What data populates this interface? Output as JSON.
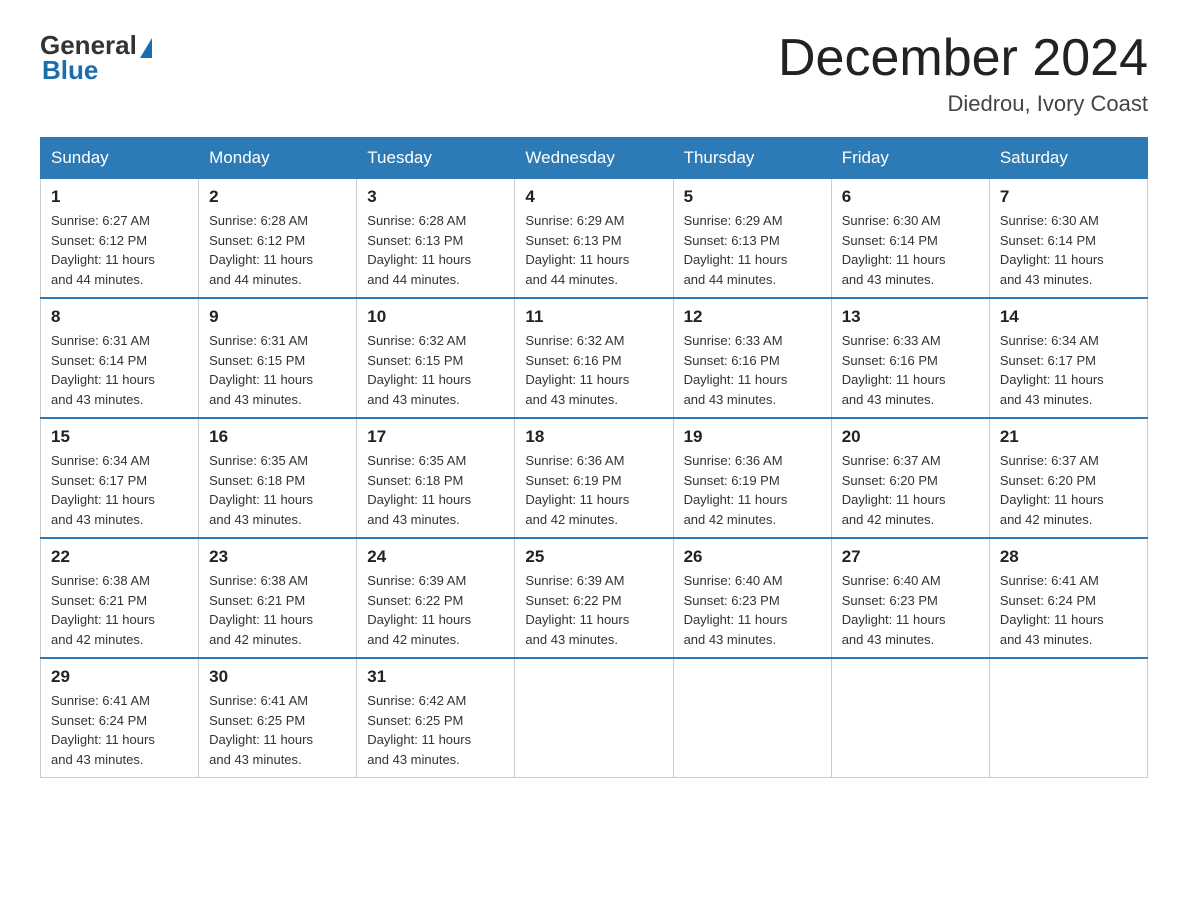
{
  "logo": {
    "general": "General",
    "blue": "Blue"
  },
  "title": "December 2024",
  "location": "Diedrou, Ivory Coast",
  "days_of_week": [
    "Sunday",
    "Monday",
    "Tuesday",
    "Wednesday",
    "Thursday",
    "Friday",
    "Saturday"
  ],
  "weeks": [
    [
      {
        "day": "1",
        "info": "Sunrise: 6:27 AM\nSunset: 6:12 PM\nDaylight: 11 hours\nand 44 minutes."
      },
      {
        "day": "2",
        "info": "Sunrise: 6:28 AM\nSunset: 6:12 PM\nDaylight: 11 hours\nand 44 minutes."
      },
      {
        "day": "3",
        "info": "Sunrise: 6:28 AM\nSunset: 6:13 PM\nDaylight: 11 hours\nand 44 minutes."
      },
      {
        "day": "4",
        "info": "Sunrise: 6:29 AM\nSunset: 6:13 PM\nDaylight: 11 hours\nand 44 minutes."
      },
      {
        "day": "5",
        "info": "Sunrise: 6:29 AM\nSunset: 6:13 PM\nDaylight: 11 hours\nand 44 minutes."
      },
      {
        "day": "6",
        "info": "Sunrise: 6:30 AM\nSunset: 6:14 PM\nDaylight: 11 hours\nand 43 minutes."
      },
      {
        "day": "7",
        "info": "Sunrise: 6:30 AM\nSunset: 6:14 PM\nDaylight: 11 hours\nand 43 minutes."
      }
    ],
    [
      {
        "day": "8",
        "info": "Sunrise: 6:31 AM\nSunset: 6:14 PM\nDaylight: 11 hours\nand 43 minutes."
      },
      {
        "day": "9",
        "info": "Sunrise: 6:31 AM\nSunset: 6:15 PM\nDaylight: 11 hours\nand 43 minutes."
      },
      {
        "day": "10",
        "info": "Sunrise: 6:32 AM\nSunset: 6:15 PM\nDaylight: 11 hours\nand 43 minutes."
      },
      {
        "day": "11",
        "info": "Sunrise: 6:32 AM\nSunset: 6:16 PM\nDaylight: 11 hours\nand 43 minutes."
      },
      {
        "day": "12",
        "info": "Sunrise: 6:33 AM\nSunset: 6:16 PM\nDaylight: 11 hours\nand 43 minutes."
      },
      {
        "day": "13",
        "info": "Sunrise: 6:33 AM\nSunset: 6:16 PM\nDaylight: 11 hours\nand 43 minutes."
      },
      {
        "day": "14",
        "info": "Sunrise: 6:34 AM\nSunset: 6:17 PM\nDaylight: 11 hours\nand 43 minutes."
      }
    ],
    [
      {
        "day": "15",
        "info": "Sunrise: 6:34 AM\nSunset: 6:17 PM\nDaylight: 11 hours\nand 43 minutes."
      },
      {
        "day": "16",
        "info": "Sunrise: 6:35 AM\nSunset: 6:18 PM\nDaylight: 11 hours\nand 43 minutes."
      },
      {
        "day": "17",
        "info": "Sunrise: 6:35 AM\nSunset: 6:18 PM\nDaylight: 11 hours\nand 43 minutes."
      },
      {
        "day": "18",
        "info": "Sunrise: 6:36 AM\nSunset: 6:19 PM\nDaylight: 11 hours\nand 42 minutes."
      },
      {
        "day": "19",
        "info": "Sunrise: 6:36 AM\nSunset: 6:19 PM\nDaylight: 11 hours\nand 42 minutes."
      },
      {
        "day": "20",
        "info": "Sunrise: 6:37 AM\nSunset: 6:20 PM\nDaylight: 11 hours\nand 42 minutes."
      },
      {
        "day": "21",
        "info": "Sunrise: 6:37 AM\nSunset: 6:20 PM\nDaylight: 11 hours\nand 42 minutes."
      }
    ],
    [
      {
        "day": "22",
        "info": "Sunrise: 6:38 AM\nSunset: 6:21 PM\nDaylight: 11 hours\nand 42 minutes."
      },
      {
        "day": "23",
        "info": "Sunrise: 6:38 AM\nSunset: 6:21 PM\nDaylight: 11 hours\nand 42 minutes."
      },
      {
        "day": "24",
        "info": "Sunrise: 6:39 AM\nSunset: 6:22 PM\nDaylight: 11 hours\nand 42 minutes."
      },
      {
        "day": "25",
        "info": "Sunrise: 6:39 AM\nSunset: 6:22 PM\nDaylight: 11 hours\nand 43 minutes."
      },
      {
        "day": "26",
        "info": "Sunrise: 6:40 AM\nSunset: 6:23 PM\nDaylight: 11 hours\nand 43 minutes."
      },
      {
        "day": "27",
        "info": "Sunrise: 6:40 AM\nSunset: 6:23 PM\nDaylight: 11 hours\nand 43 minutes."
      },
      {
        "day": "28",
        "info": "Sunrise: 6:41 AM\nSunset: 6:24 PM\nDaylight: 11 hours\nand 43 minutes."
      }
    ],
    [
      {
        "day": "29",
        "info": "Sunrise: 6:41 AM\nSunset: 6:24 PM\nDaylight: 11 hours\nand 43 minutes."
      },
      {
        "day": "30",
        "info": "Sunrise: 6:41 AM\nSunset: 6:25 PM\nDaylight: 11 hours\nand 43 minutes."
      },
      {
        "day": "31",
        "info": "Sunrise: 6:42 AM\nSunset: 6:25 PM\nDaylight: 11 hours\nand 43 minutes."
      },
      {
        "day": "",
        "info": ""
      },
      {
        "day": "",
        "info": ""
      },
      {
        "day": "",
        "info": ""
      },
      {
        "day": "",
        "info": ""
      }
    ]
  ]
}
